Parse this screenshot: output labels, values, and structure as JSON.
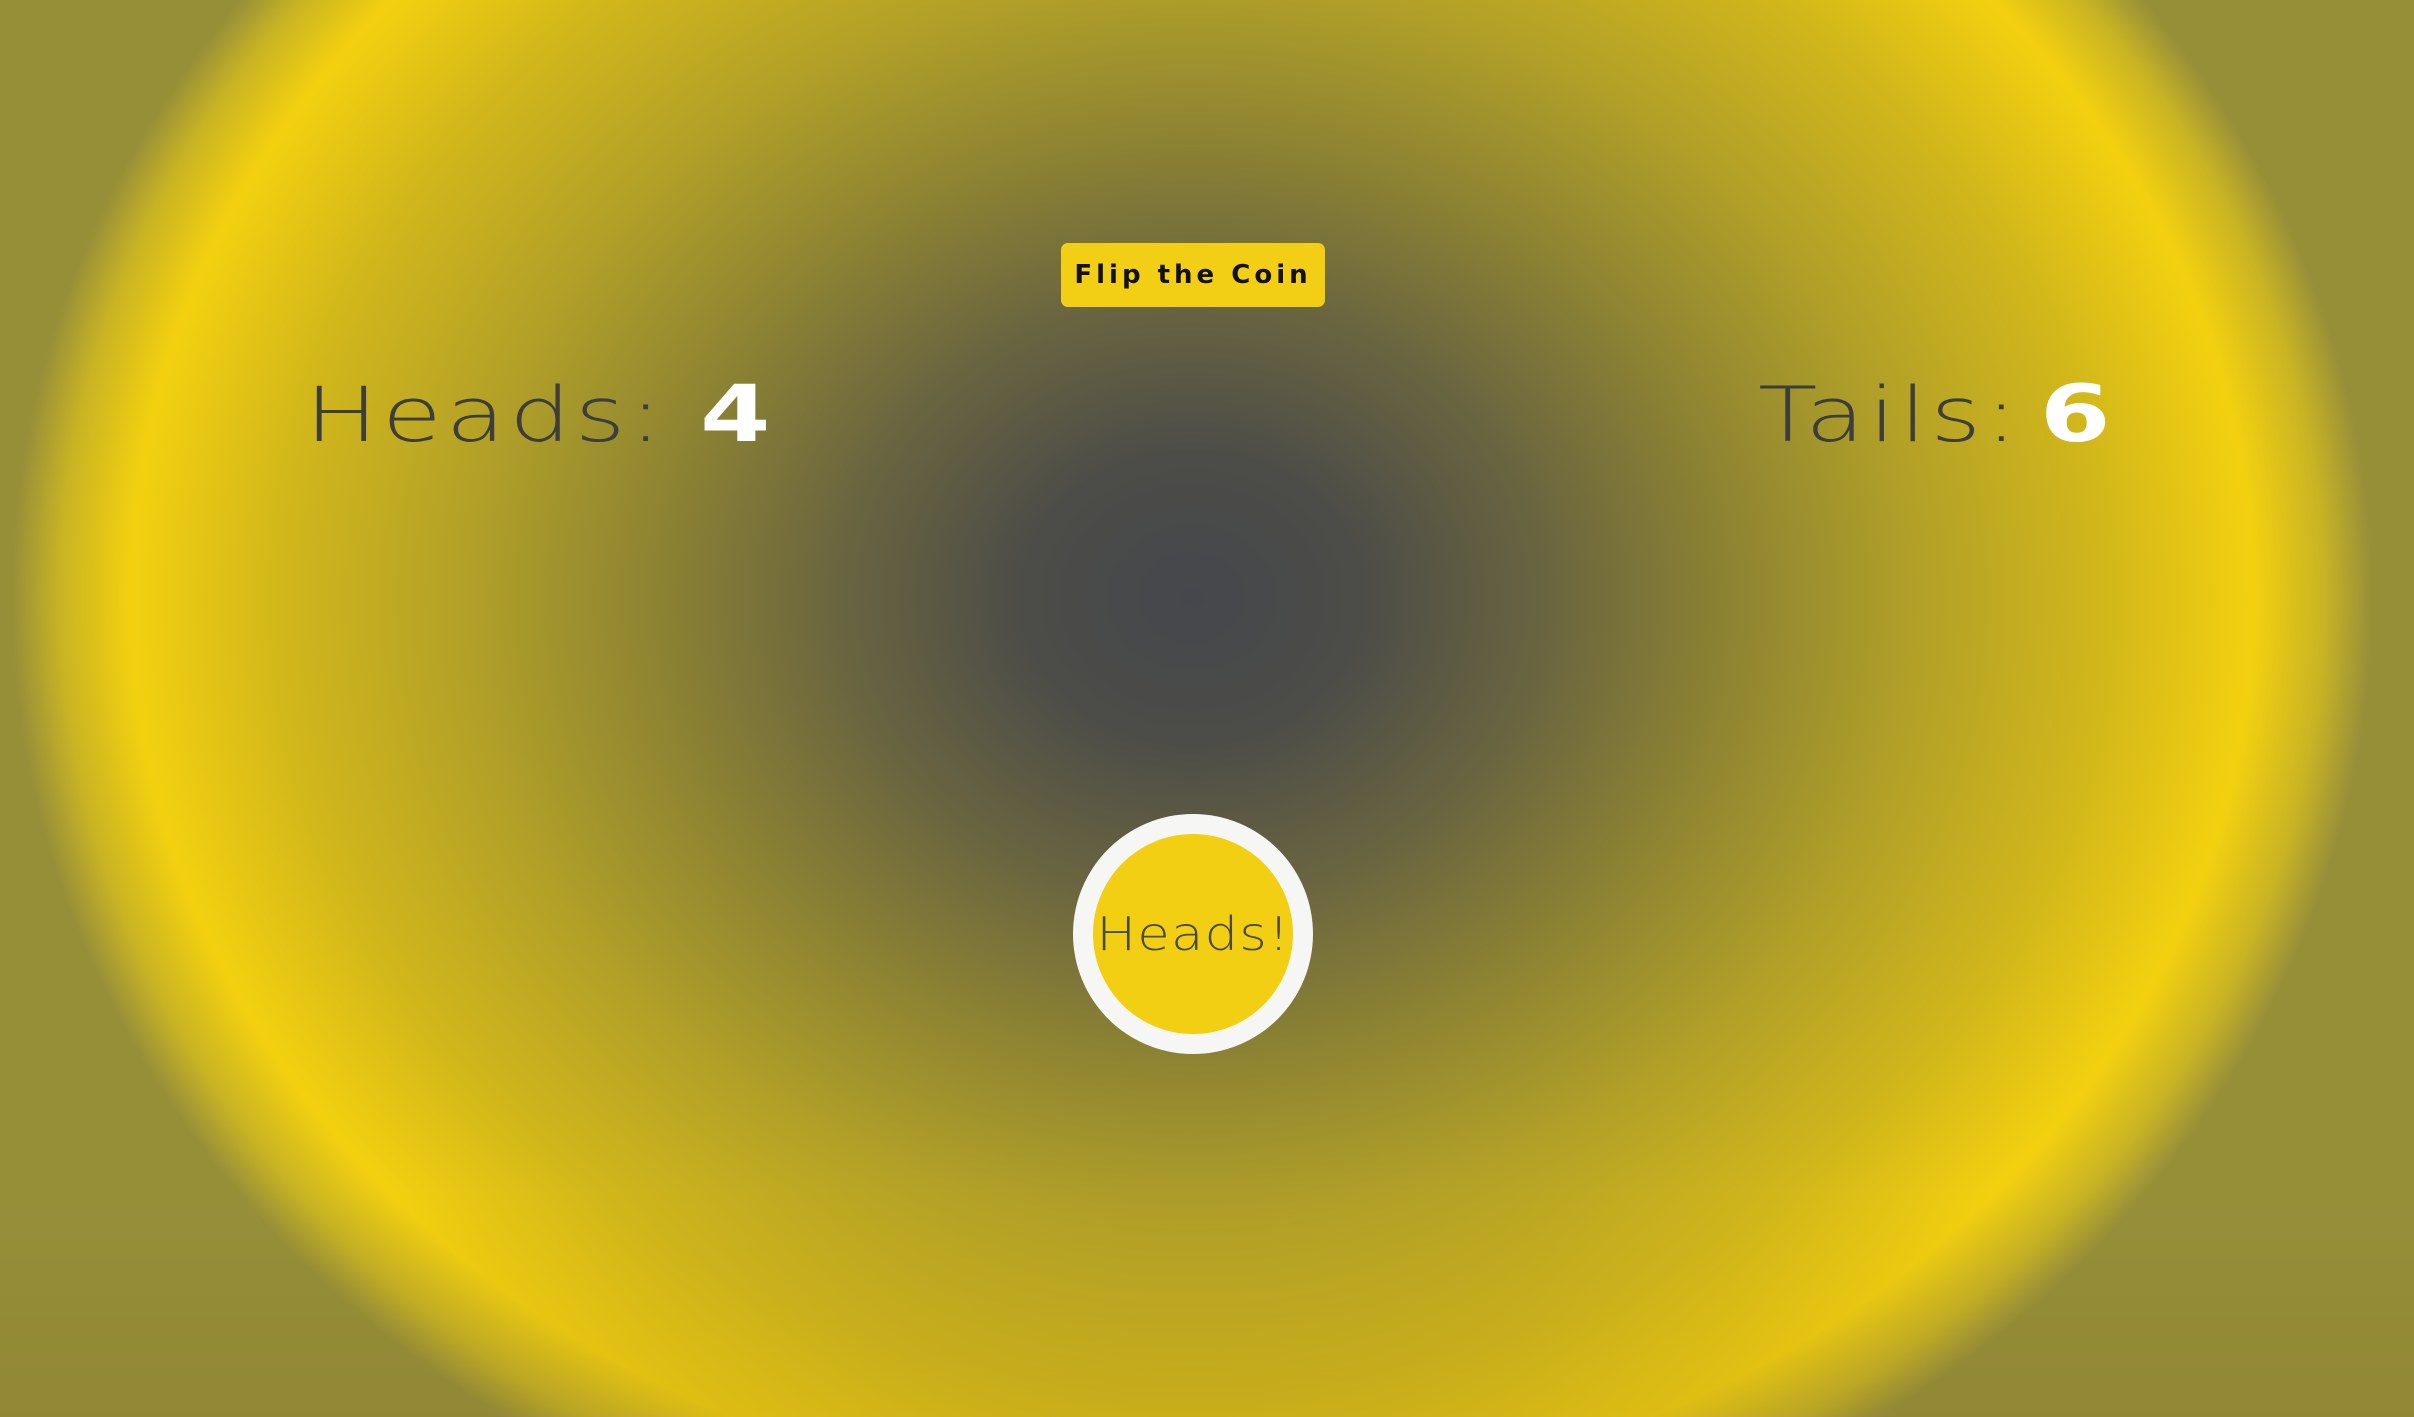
{
  "controls": {
    "flip_button_label": "Flip the Coin"
  },
  "scoreboard": {
    "heads": {
      "label": "Heads:",
      "value": "4"
    },
    "tails": {
      "label": "Tails:",
      "value": "6"
    }
  },
  "coin": {
    "result": "Heads!"
  },
  "colors": {
    "accent": "#f2cf15",
    "center": "#45474c",
    "label_text": "#3d3d3a",
    "score_value": "#ffffff",
    "coin_rim": "#f6f6f4"
  }
}
